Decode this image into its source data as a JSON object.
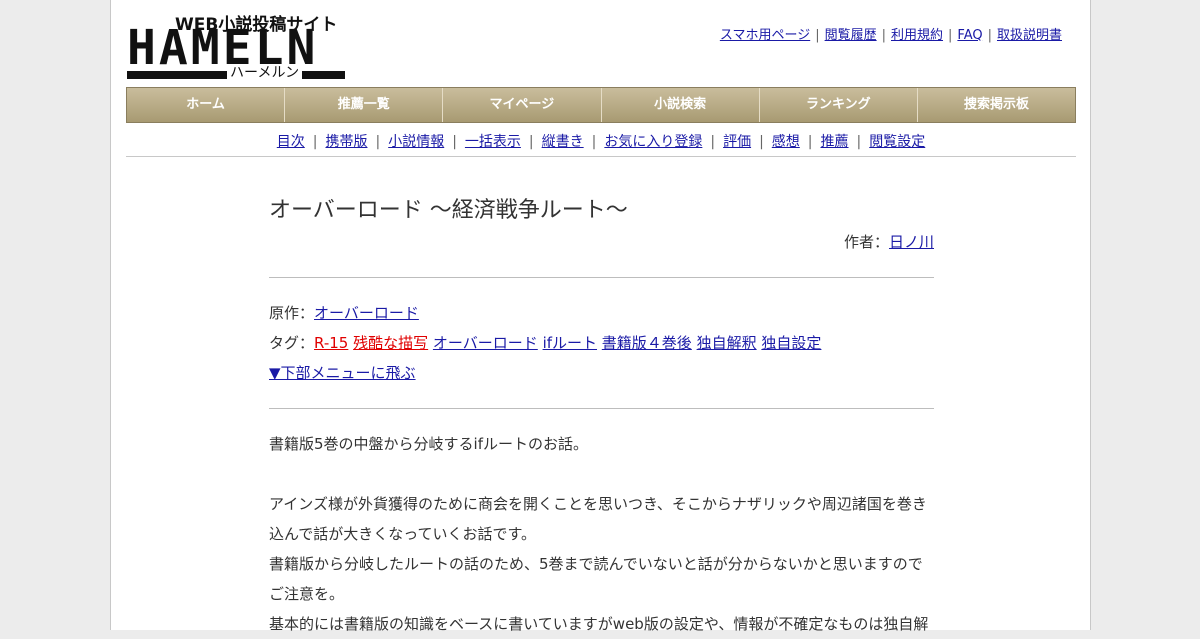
{
  "logo": {
    "subtitle": "WEB小説投稿サイト",
    "name": "HAMELN",
    "kana": "ハーメルン"
  },
  "top_links": [
    "スマホ用ページ",
    "閲覧履歴",
    "利用規約",
    "FAQ",
    "取扱説明書"
  ],
  "main_nav": [
    "ホーム",
    "推薦一覧",
    "マイページ",
    "小説検索",
    "ランキング",
    "捜索掲示板"
  ],
  "sub_nav": [
    "目次",
    "携帯版",
    "小説情報",
    "一括表示",
    "縦書き",
    "お気に入り登録",
    "評価",
    "感想",
    "推薦",
    "閲覧設定"
  ],
  "novel": {
    "title": "オーバーロード ～経済戦争ルート～",
    "author_label": "作者：",
    "author": "日ノ川",
    "original_label": "原作：",
    "original": "オーバーロード",
    "tags_label": "タグ：",
    "tags_red": [
      "R-15",
      "残酷な描写"
    ],
    "tags": [
      "オーバーロード",
      "ifルート",
      "書籍版４巻後",
      "独自解釈",
      "独自設定"
    ],
    "jump_link": "▼下部メニューに飛ぶ",
    "paragraphs": [
      "書籍版5巻の中盤から分岐するifルートのお話。",
      "",
      "アインズ様が外貨獲得のために商会を開くことを思いつき、そこからナザリックや周辺諸国を巻き込んで話が大きくなっていくお話です。",
      "書籍版から分岐したルートの話のため、5巻まで読んでいないと話が分からないかと思いますのでご注意を。",
      "基本的には書籍版の知識をベースに書いていますがweb版の設定や、情報が不確定なものは独自解"
    ]
  },
  "colors": {
    "nav_tab_top": "#c9bd9c",
    "nav_tab_bottom": "#a89a72",
    "link": "#1a1aa6",
    "tag_red": "#e00000"
  }
}
